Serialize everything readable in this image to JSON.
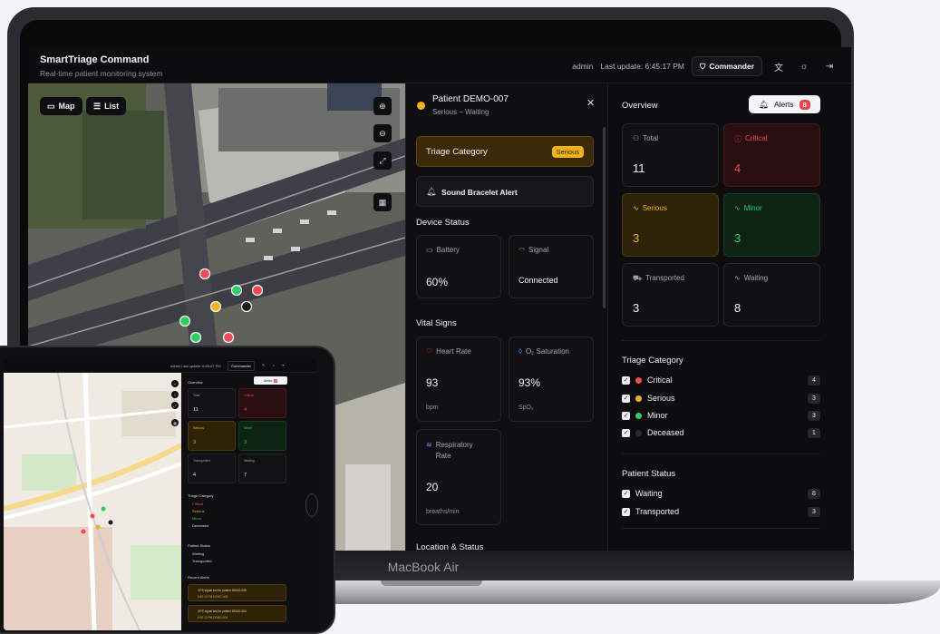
{
  "app": {
    "title": "SmartTriage Command",
    "subtitle": "Real-time patient monitoring system",
    "user": "admin",
    "last_update": "Last update: 6:45:17 PM",
    "role_button": "Commander"
  },
  "map": {
    "map_toggle": "Map",
    "list_toggle": "List"
  },
  "patient": {
    "name": "Patient DEMO-007",
    "status": "Serious – Waiting",
    "triage_label": "Triage Category",
    "triage_value": "Serious",
    "sound_alert": "Sound Bracelet Alert",
    "device_status_title": "Device Status",
    "battery_label": "Battery",
    "battery_value": "60%",
    "signal_label": "Signal",
    "signal_value": "Connected",
    "vitals_title": "Vital Signs",
    "heart_rate_label": "Heart Rate",
    "heart_rate_value": "93",
    "heart_rate_unit": "bpm",
    "o2_label": "O₂ Saturation",
    "o2_value": "93%",
    "o2_unit": "SpO₂",
    "resp_label": "Respiratory Rate",
    "resp_value": "20",
    "resp_unit": "breaths/min",
    "location_title": "Location & Status"
  },
  "overview": {
    "title": "Overview",
    "alerts_label": "Alerts",
    "alerts_count": "8",
    "stats": {
      "total_label": "Total",
      "total_value": "11",
      "critical_label": "Critical",
      "critical_value": "4",
      "serious_label": "Serious",
      "serious_value": "3",
      "minor_label": "Minor",
      "minor_value": "3",
      "transported_label": "Transported",
      "transported_value": "3",
      "waiting_label": "Waiting",
      "waiting_value": "8"
    },
    "triage_title": "Triage Category",
    "triage": [
      {
        "label": "Critical",
        "count": "4",
        "color": "#ef4a55"
      },
      {
        "label": "Serious",
        "count": "3",
        "color": "#f2b21b"
      },
      {
        "label": "Minor",
        "count": "3",
        "color": "#2fce63"
      },
      {
        "label": "Deceased",
        "count": "1",
        "color": "#2a2b30"
      }
    ],
    "patient_status_title": "Patient Status",
    "status": [
      {
        "label": "Waiting",
        "count": "8"
      },
      {
        "label": "Transported",
        "count": "3"
      }
    ]
  },
  "device_label": "MacBook Air",
  "tablet": {
    "header_user": "admin  Last update: 6:55:07 PM",
    "header_role": "Commander",
    "overview_title": "Overview",
    "alerts_label": "Alerts",
    "alerts_count": "2",
    "stats": {
      "total_label": "Total",
      "total_value": "11",
      "critical_label": "Critical",
      "critical_value": "4",
      "serious_label": "Serious",
      "serious_value": "3",
      "minor_label": "Minor",
      "minor_value": "3",
      "transported_label": "Transported",
      "transported_value": "4",
      "waiting_label": "Waiting",
      "waiting_value": "7"
    },
    "triage_title": "Triage Category",
    "triage": [
      "Critical",
      "Serious",
      "Minor",
      "Deceased"
    ],
    "patient_status_title": "Patient Status",
    "status": [
      "Waiting",
      "Transported"
    ],
    "recent_alerts_title": "Recent Alerts",
    "alerts": [
      {
        "text": "GPS signal lost for patient DEMO-008",
        "meta": "6:50:12 PM  DEMO-008"
      },
      {
        "text": "GPS signal lost for patient DEMO-004",
        "meta": "6:50:12 PM  DEMO-004"
      }
    ]
  },
  "colors": {
    "critical": "#ef4a55",
    "serious": "#f2b21b",
    "minor": "#2fce63",
    "deceased": "#2a2b30"
  }
}
